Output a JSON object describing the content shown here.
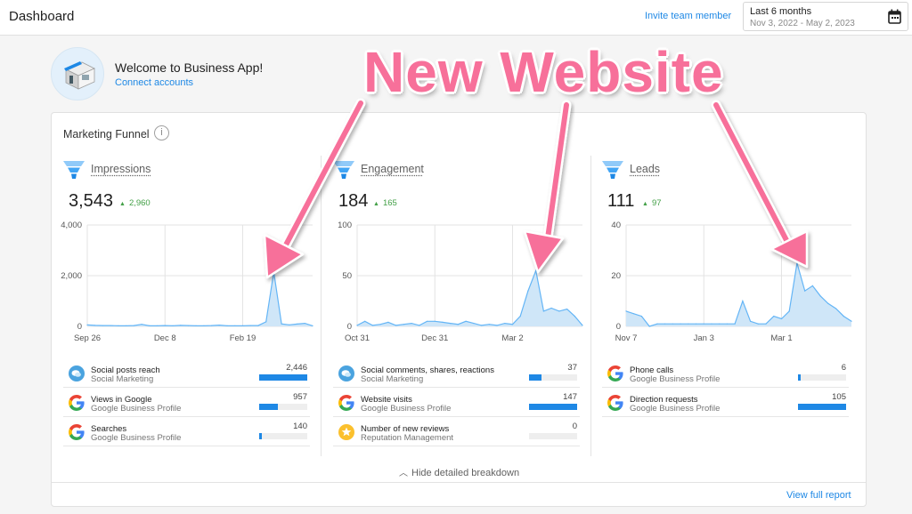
{
  "header": {
    "title": "Dashboard",
    "invite_label": "Invite team member",
    "date_range": {
      "label": "Last 6 months",
      "dates": "Nov 3, 2022 - May 2, 2023"
    }
  },
  "welcome": {
    "title": "Welcome to Business App!",
    "connect_label": "Connect accounts"
  },
  "funnel": {
    "title": "Marketing Funnel",
    "info_glyph": "i",
    "hide_label": "Hide detailed breakdown",
    "view_report_label": "View full report",
    "columns": [
      {
        "title": "Impressions",
        "value": "3,543",
        "delta": "2,960",
        "rows": [
          {
            "icon": "social-icon",
            "title": "Social posts reach",
            "sub": "Social Marketing",
            "count": "2,446",
            "fill": 1.0
          },
          {
            "icon": "google-icon",
            "title": "Views in Google",
            "sub": "Google Business Profile",
            "count": "957",
            "fill": 0.39
          },
          {
            "icon": "google-icon",
            "title": "Searches",
            "sub": "Google Business Profile",
            "count": "140",
            "fill": 0.06
          }
        ]
      },
      {
        "title": "Engagement",
        "value": "184",
        "delta": "165",
        "rows": [
          {
            "icon": "social-icon",
            "title": "Social comments, shares, reactions",
            "sub": "Social Marketing",
            "count": "37",
            "fill": 0.25
          },
          {
            "icon": "google-icon",
            "title": "Website visits",
            "sub": "Google Business Profile",
            "count": "147",
            "fill": 1.0
          },
          {
            "icon": "star-icon",
            "title": "Number of new reviews",
            "sub": "Reputation Management",
            "count": "0",
            "fill": 0
          }
        ]
      },
      {
        "title": "Leads",
        "value": "111",
        "delta": "97",
        "rows": [
          {
            "icon": "google-icon",
            "title": "Phone calls",
            "sub": "Google Business Profile",
            "count": "6",
            "fill": 0.06
          },
          {
            "icon": "google-icon",
            "title": "Direction requests",
            "sub": "Google Business Profile",
            "count": "105",
            "fill": 1.0
          }
        ]
      }
    ]
  },
  "chart_data": [
    {
      "type": "area",
      "title": "Impressions",
      "ylim": [
        0,
        4000
      ],
      "y_ticks": [
        "0",
        "2,000",
        "4,000"
      ],
      "x_ticks": [
        {
          "label": "Sep 26",
          "index": 0
        },
        {
          "label": "Dec 8",
          "index": 10
        },
        {
          "label": "Feb 19",
          "index": 20
        }
      ],
      "values": [
        60,
        40,
        30,
        30,
        20,
        20,
        30,
        80,
        20,
        20,
        30,
        20,
        40,
        30,
        20,
        20,
        30,
        50,
        20,
        20,
        20,
        30,
        30,
        180,
        2150,
        100,
        60,
        90,
        120,
        20
      ]
    },
    {
      "type": "area",
      "title": "Engagement",
      "ylim": [
        0,
        100
      ],
      "y_ticks": [
        "0",
        "50",
        "100"
      ],
      "x_ticks": [
        {
          "label": "Oct 31",
          "index": 0
        },
        {
          "label": "Dec 31",
          "index": 10
        },
        {
          "label": "Mar 2",
          "index": 20
        }
      ],
      "values": [
        1,
        5,
        1,
        2,
        4,
        1,
        2,
        3,
        1,
        5,
        5,
        4,
        3,
        2,
        5,
        3,
        1,
        2,
        1,
        3,
        2,
        10,
        35,
        55,
        15,
        18,
        15,
        17,
        10,
        1
      ]
    },
    {
      "type": "area",
      "title": "Leads",
      "ylim": [
        0,
        40
      ],
      "y_ticks": [
        "0",
        "20",
        "40"
      ],
      "x_ticks": [
        {
          "label": "Nov 7",
          "index": 0
        },
        {
          "label": "Jan 3",
          "index": 10
        },
        {
          "label": "Mar 1",
          "index": 20
        }
      ],
      "values": [
        6,
        5,
        4,
        0,
        1,
        1,
        1,
        1,
        1,
        1,
        1,
        1,
        1,
        1,
        1,
        10,
        2,
        1,
        1,
        4,
        3,
        6,
        25,
        14,
        16,
        12,
        9,
        7,
        4,
        2
      ]
    }
  ],
  "colors": {
    "accent": "#1e88e5",
    "delta_green": "#43a047",
    "area_fill": "#cfe6f8",
    "area_line": "#64b5f6",
    "overlay_pink": "#f7709a"
  },
  "overlay": {
    "text": "New Website"
  }
}
